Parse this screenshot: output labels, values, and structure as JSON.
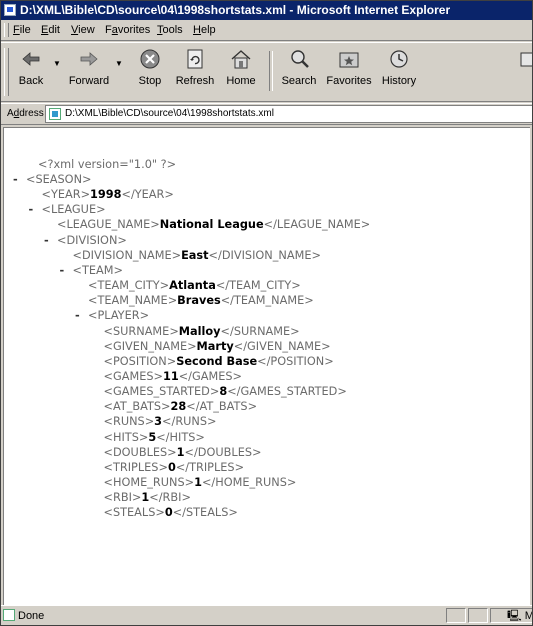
{
  "window": {
    "title": "D:\\XML\\Bible\\CD\\source\\04\\1998shortstats.xml - Microsoft Internet Explorer"
  },
  "menu": {
    "items": [
      "File",
      "Edit",
      "View",
      "Favorites",
      "Tools",
      "Help"
    ],
    "accelerators": [
      "F",
      "E",
      "V",
      "a",
      "T",
      "H"
    ]
  },
  "toolbar": {
    "buttons": [
      {
        "label": "Back",
        "icon": "back-arrow-icon"
      },
      {
        "label": "Forward",
        "icon": "forward-arrow-icon"
      },
      {
        "label": "Stop",
        "icon": "stop-icon"
      },
      {
        "label": "Refresh",
        "icon": "refresh-icon"
      },
      {
        "label": "Home",
        "icon": "home-icon"
      },
      {
        "label": "Search",
        "icon": "search-icon"
      },
      {
        "label": "Favorites",
        "icon": "favorites-icon"
      },
      {
        "label": "History",
        "icon": "history-icon"
      }
    ]
  },
  "address": {
    "label": "Address",
    "value": "D:\\XML\\Bible\\CD\\source\\04\\1998shortstats.xml"
  },
  "xml": {
    "declaration": "<?xml version=\"1.0\" ?>",
    "minus": "-",
    "lines": [
      {
        "open": "<SEASON>",
        "value": "",
        "close": ""
      },
      {
        "open": "<YEAR>",
        "value": "1998",
        "close": "</YEAR>"
      },
      {
        "open": "<LEAGUE>",
        "value": "",
        "close": ""
      },
      {
        "open": "<LEAGUE_NAME>",
        "value": "National League",
        "close": "</LEAGUE_NAME>"
      },
      {
        "open": "<DIVISION>",
        "value": "",
        "close": ""
      },
      {
        "open": "<DIVISION_NAME>",
        "value": "East",
        "close": "</DIVISION_NAME>"
      },
      {
        "open": "<TEAM>",
        "value": "",
        "close": ""
      },
      {
        "open": "<TEAM_CITY>",
        "value": "Atlanta",
        "close": "</TEAM_CITY>"
      },
      {
        "open": "<TEAM_NAME>",
        "value": "Braves",
        "close": "</TEAM_NAME>"
      },
      {
        "open": "<PLAYER>",
        "value": "",
        "close": ""
      },
      {
        "open": "<SURNAME>",
        "value": "Malloy",
        "close": "</SURNAME>"
      },
      {
        "open": "<GIVEN_NAME>",
        "value": "Marty",
        "close": "</GIVEN_NAME>"
      },
      {
        "open": "<POSITION>",
        "value": "Second Base",
        "close": "</POSITION>"
      },
      {
        "open": "<GAMES>",
        "value": "11",
        "close": "</GAMES>"
      },
      {
        "open": "<GAMES_STARTED>",
        "value": "8",
        "close": "</GAMES_STARTED>"
      },
      {
        "open": "<AT_BATS>",
        "value": "28",
        "close": "</AT_BATS>"
      },
      {
        "open": "<RUNS>",
        "value": "3",
        "close": "</RUNS>"
      },
      {
        "open": "<HITS>",
        "value": "5",
        "close": "</HITS>"
      },
      {
        "open": "<DOUBLES>",
        "value": "1",
        "close": "</DOUBLES>"
      },
      {
        "open": "<TRIPLES>",
        "value": "0",
        "close": "</TRIPLES>"
      },
      {
        "open": "<HOME_RUNS>",
        "value": "1",
        "close": "</HOME_RUNS>"
      },
      {
        "open": "<RBI>",
        "value": "1",
        "close": "</RBI>"
      },
      {
        "open": "<STEALS>",
        "value": "0",
        "close": "</STEALS>"
      }
    ]
  },
  "status": {
    "text": "Done",
    "zone": "My"
  }
}
